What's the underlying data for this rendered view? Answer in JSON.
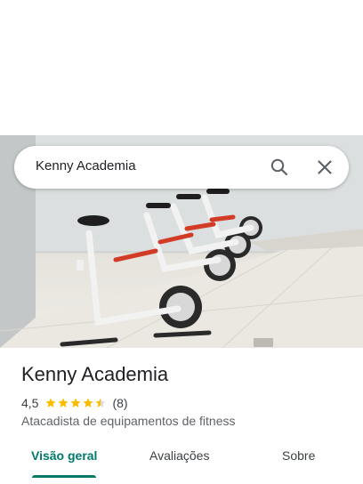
{
  "search": {
    "query": "Kenny Academia"
  },
  "place": {
    "name": "Kenny Academia",
    "rating": "4,5",
    "stars": 4.5,
    "review_count": "(8)",
    "category": "Atacadista de equipamentos de fitness"
  },
  "tabs": [
    {
      "label": "Visão geral",
      "active": true
    },
    {
      "label": "Avaliações",
      "active": false
    },
    {
      "label": "Sobre",
      "active": false
    }
  ],
  "colors": {
    "accent": "#00796b",
    "star": "#fbbc04",
    "text": "#202124"
  },
  "icons": {
    "search": "search-icon",
    "close": "close-icon"
  }
}
